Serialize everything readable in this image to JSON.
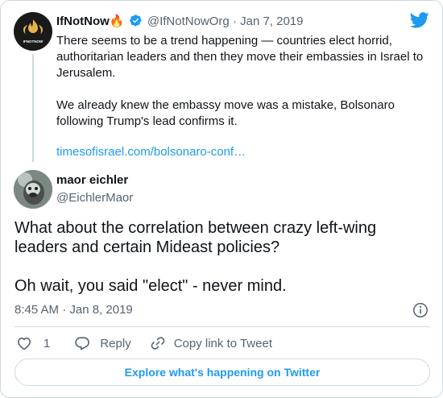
{
  "parent": {
    "name": "IfNotNow🔥",
    "handle": "@IfNotNowOrg",
    "separator": "·",
    "date": "Jan 7, 2019",
    "avatar_text": "IFNOTNOW",
    "paragraphs": [
      "There seems to be a trend happening — countries elect horrid, authoritarian leaders and then they move their embassies in Israel to Jerusalem.",
      "We already knew the embassy move was a mistake, Bolsonaro following Trump's lead confirms it."
    ],
    "link": "timesofisrael.com/bolsonaro-conf…"
  },
  "reply": {
    "name": "maor eichler",
    "handle": "@EichlerMaor",
    "paragraphs": [
      "What about the correlation between crazy left-wing leaders and certain Mideast policies?",
      "Oh wait, you said \"elect\" - never mind."
    ],
    "timestamp": "8:45 AM · Jan 8, 2019"
  },
  "actions": {
    "like_count": "1",
    "reply_label": "Reply",
    "copy_label": "Copy link to Tweet"
  },
  "explore_label": "Explore what's happening on Twitter",
  "colors": {
    "accent": "#1d9bf0",
    "muted": "#536471",
    "border": "#cfd9de",
    "verified": "#1d9bf0",
    "flame": "#f5a623"
  },
  "icons": [
    "twitter-bird-icon",
    "verified-badge-icon",
    "info-icon",
    "heart-icon",
    "reply-icon",
    "link-icon"
  ]
}
